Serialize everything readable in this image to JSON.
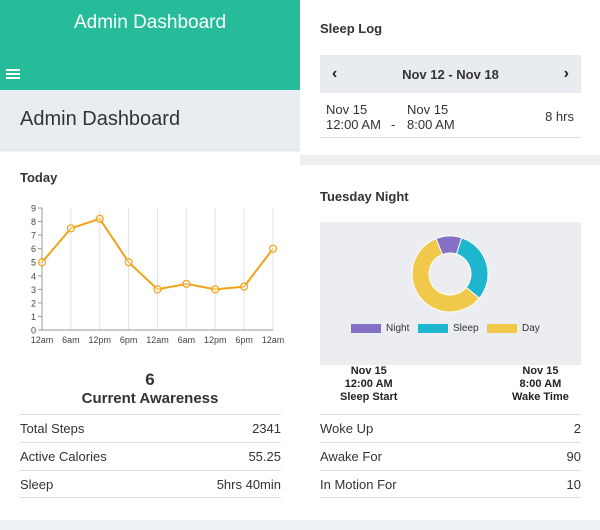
{
  "topbar": {
    "title": "Admin Dashboard"
  },
  "page": {
    "heading": "Admin Dashboard"
  },
  "today": {
    "title": "Today",
    "awareness_value": "6",
    "awareness_label": "Current Awareness",
    "stats": [
      {
        "label": "Total Steps",
        "value": "2341"
      },
      {
        "label": "Active Calories",
        "value": "55.25"
      },
      {
        "label": "Sleep",
        "value": "5hrs 40min"
      }
    ]
  },
  "chart_data": {
    "type": "line",
    "x": [
      "12am",
      "6am",
      "12pm",
      "6pm",
      "12am",
      "6am",
      "12pm",
      "6pm",
      "12am"
    ],
    "values": [
      5,
      7.5,
      8.2,
      5,
      3,
      3.4,
      3,
      3.2,
      6
    ],
    "ylim": [
      0,
      9
    ],
    "yticks": [
      "0",
      "1",
      "2",
      "3",
      "4",
      "5",
      "6",
      "7",
      "8",
      "9"
    ],
    "color": "#f0a31a"
  },
  "sleep_log": {
    "title": "Sleep Log",
    "range": "Nov 12 - Nov 18",
    "prev_icon": "chevron-left-icon",
    "next_icon": "chevron-right-icon",
    "entry": {
      "start_date": "Nov 15",
      "start_time": "12:00 AM",
      "separator": "-",
      "end_date": "Nov 15",
      "end_time": "8:00 AM",
      "duration": "8 hrs"
    }
  },
  "tuesday": {
    "title": "Tuesday Night",
    "legend": [
      {
        "label": "Night",
        "color": "#8470c4"
      },
      {
        "label": "Sleep",
        "color": "#1eb5cf"
      },
      {
        "label": "Day",
        "color": "#f1c94a"
      }
    ],
    "donut_values": {
      "Night": 11,
      "Sleep": 31,
      "Day": 58
    },
    "start": {
      "date": "Nov 15",
      "time": "12:00 AM",
      "label": "Sleep Start"
    },
    "end": {
      "date": "Nov 15",
      "time": "8:00 AM",
      "label": "Wake Time"
    },
    "stats": [
      {
        "label": "Woke Up",
        "value": "2"
      },
      {
        "label": "Awake For",
        "value": "90"
      },
      {
        "label": "In Motion For",
        "value": "10"
      }
    ]
  }
}
